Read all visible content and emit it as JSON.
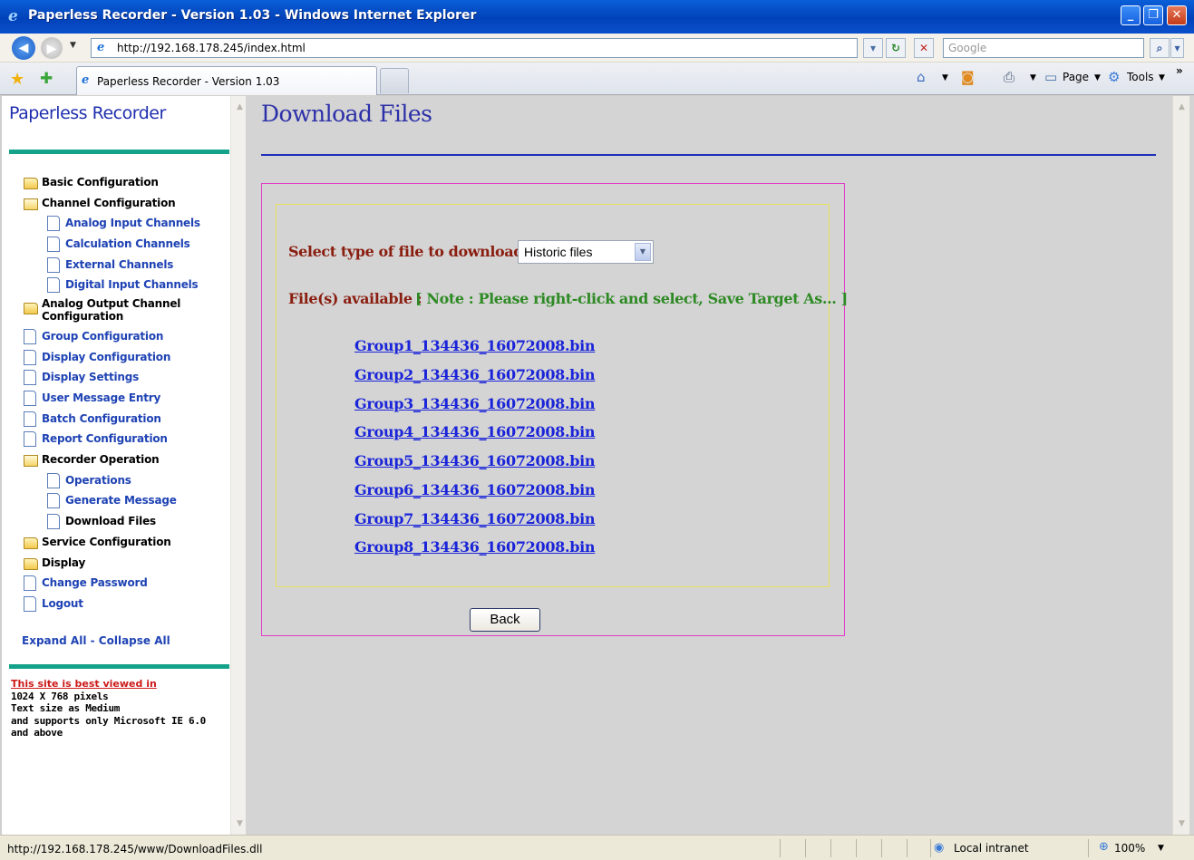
{
  "window": {
    "title": "Paperless Recorder - Version 1.03 - Windows Internet Explorer",
    "minimize": "_",
    "maximize": "❐",
    "close": "✕"
  },
  "address_bar": {
    "url": "http://192.168.178.245/index.html",
    "search_placeholder": "Google"
  },
  "tabs": {
    "active_tab": "Paperless Recorder - Version 1.03"
  },
  "commands": {
    "page": "Page",
    "tools": "Tools",
    "more": "»"
  },
  "sidebar": {
    "title": "Paperless Recorder",
    "items": [
      {
        "label": "Basic Configuration",
        "icon": "folder-icon"
      },
      {
        "label": "Channel Configuration",
        "icon": "folder-open-icon"
      },
      {
        "label": "Analog Input Channels",
        "icon": "document-icon"
      },
      {
        "label": "Calculation Channels",
        "icon": "document-icon"
      },
      {
        "label": "External Channels",
        "icon": "document-icon"
      },
      {
        "label": "Digital Input Channels",
        "icon": "document-icon"
      },
      {
        "label_line1": "Analog Output Channel",
        "label_line2": "Configuration",
        "icon": "folder-icon"
      },
      {
        "label": "Group Configuration",
        "icon": "document-icon"
      },
      {
        "label": "Display Configuration",
        "icon": "document-icon"
      },
      {
        "label": "Display Settings",
        "icon": "document-icon"
      },
      {
        "label": "User Message Entry",
        "icon": "document-icon"
      },
      {
        "label": "Batch Configuration",
        "icon": "document-icon"
      },
      {
        "label": "Report Configuration",
        "icon": "document-icon"
      },
      {
        "label": "Recorder Operation",
        "icon": "folder-open-icon"
      },
      {
        "label": "Operations",
        "icon": "document-icon"
      },
      {
        "label": "Generate Message",
        "icon": "document-icon"
      },
      {
        "label": "Download Files",
        "icon": "document-icon"
      },
      {
        "label": "Service Configuration",
        "icon": "folder-icon"
      },
      {
        "label": "Display",
        "icon": "folder-icon"
      },
      {
        "label": "Change Password",
        "icon": "document-icon"
      },
      {
        "label": "Logout",
        "icon": "document-icon"
      }
    ],
    "expand_collapse": "Expand All - Collapse All",
    "best_viewed": "This site is best viewed in",
    "notes": [
      "1024 X 768 pixels",
      "Text size as Medium",
      "and supports only Microsoft IE 6.0",
      "and above"
    ]
  },
  "main": {
    "title": "Download Files",
    "select_label": "Select type of file to download",
    "select_value": "Historic files",
    "available_label": "File(s) available :",
    "note": "[ Note : Please right-click and select, Save Target As... ]",
    "files": [
      "Group1_134436_16072008.bin",
      "Group2_134436_16072008.bin",
      "Group3_134436_16072008.bin",
      "Group4_134436_16072008.bin",
      "Group5_134436_16072008.bin",
      "Group6_134436_16072008.bin",
      "Group7_134436_16072008.bin",
      "Group8_134436_16072008.bin"
    ],
    "back_button": "Back"
  },
  "status_bar": {
    "text": "http://192.168.178.245/www/DownloadFiles.dll",
    "zone": "Local intranet",
    "zoom": "100%"
  }
}
